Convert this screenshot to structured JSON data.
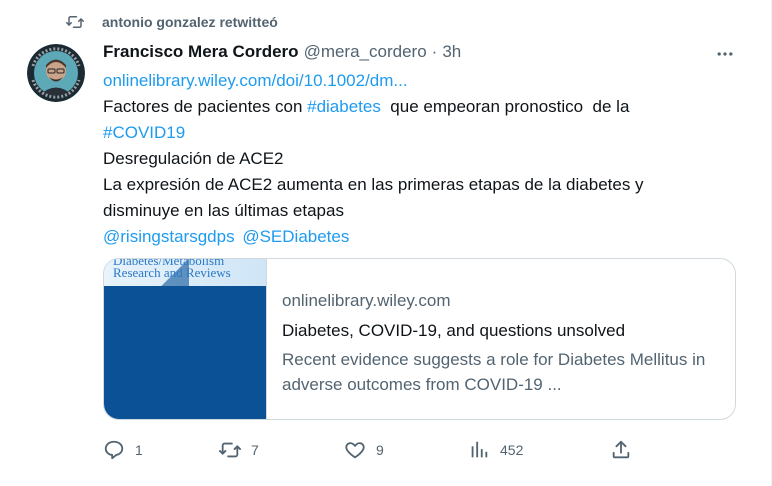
{
  "retweet": {
    "label": "antonio gonzalez retwitteó",
    "icon": "retweet-icon"
  },
  "author": {
    "name": "Francisco Mera Cordero",
    "handle": "@mera_cordero",
    "separator": "·",
    "time": "3h",
    "avatar_badge_text": "LONG COVID AWARENESS"
  },
  "tweet": {
    "link": "onlinelibrary.wiley.com/doi/10.1002/dm...",
    "line2_pre": "Factores de pacientes con ",
    "hashtag_diabetes": "#diabetes",
    "line2_post": "  que empeoran pronostico  de la",
    "hashtag_covid": "#COVID19",
    "line4": "Desregulación de ACE2",
    "line5": "La expresión de ACE2 aumenta en las primeras etapas de la diabetes y",
    "line6": "disminuye en las últimas etapas",
    "mention1": "@risingstarsgdps",
    "mention2": "@SEDiabetes"
  },
  "link_card": {
    "thumb_title1": "Diabetes/Metabolism",
    "thumb_title2": "Research and Reviews",
    "domain": "onlinelibrary.wiley.com",
    "title": "Diabetes, COVID-19, and questions unsolved",
    "description": "Recent evidence suggests a role for Diabetes Mellitus in adverse outcomes from COVID-19 ..."
  },
  "actions": {
    "replies": "1",
    "retweets": "7",
    "likes": "9",
    "views": "452"
  },
  "colors": {
    "link": "#1d9bf0",
    "secondary_text": "#536471",
    "primary_text": "#0f1419",
    "border": "#cfd9de",
    "thumb_blue": "#0b5196"
  }
}
